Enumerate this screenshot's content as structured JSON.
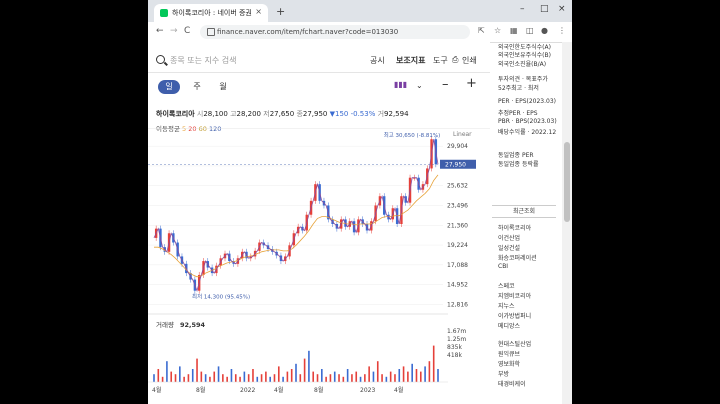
{
  "browser": {
    "tab_title": "하이록코리아 : 네이버 증권",
    "tab_close": "×",
    "new_tab": "+",
    "url": "finance.naver.com/item/fchart.naver?code=013030",
    "nav_back": "←",
    "nav_forward": "→",
    "nav_reload": "C"
  },
  "toolbar": {
    "search_placeholder": "종목 또는 지수 검색",
    "menu": [
      "공시",
      "보조지표",
      "도구",
      "인쇄"
    ]
  },
  "period_tabs": [
    "일",
    "주",
    "월"
  ],
  "stock": {
    "name": "하이록코리아",
    "open_label": "시",
    "open": "28,100",
    "high_label": "고",
    "high": "28,200",
    "low_label": "저",
    "low": "27,650",
    "close_label": "종",
    "close": "27,950",
    "change": "▼150 -0.53%",
    "volume_label": "거",
    "volume": "92,594"
  },
  "moving_avg": {
    "label": "이동평균",
    "p5": "5",
    "p20": "20",
    "p60": "60",
    "p120": "120"
  },
  "chart_data": {
    "type": "line",
    "scale_label": "Linear",
    "y_ticks": [
      29904,
      27768,
      25632,
      23496,
      21360,
      19224,
      17088,
      14952,
      12816
    ],
    "y_tick_labels": [
      "29,904",
      "27,768",
      "25,632",
      "23,496",
      "21,360",
      "19,224",
      "17,088",
      "14,952",
      "12,816"
    ],
    "ylim": [
      12000,
      31000
    ],
    "x_labels": [
      "4월",
      "8월",
      "2022",
      "4월",
      "8월",
      "2023",
      "4월"
    ],
    "high_label": "최고 30,650 (-8.81%)",
    "low_label": "최저 14,300 (95.45%)",
    "current_label": "27,950",
    "current": 27950,
    "high": 30650,
    "low": 14300,
    "price_path": [
      20000,
      21000,
      19000,
      18500,
      20500,
      19500,
      18000,
      17200,
      16200,
      15500,
      14300,
      16000,
      17500,
      16800,
      16200,
      17000,
      17800,
      18300,
      17500,
      17200,
      17800,
      18500,
      17800,
      18000,
      18600,
      19500,
      19200,
      18800,
      18500,
      18100,
      17500,
      18000,
      19200,
      20500,
      21200,
      20800,
      22500,
      24000,
      25800,
      24000,
      23500,
      22000,
      21500,
      21000,
      22000,
      21200,
      21800,
      20600,
      22000,
      21500,
      20800,
      21800,
      23500,
      24500,
      22500,
      22000,
      23200,
      21500,
      24500,
      23800,
      26500,
      26500,
      25200,
      25800,
      27500,
      30650,
      27950
    ],
    "ma_path": [
      19000,
      19000,
      18800,
      18500,
      18200,
      17800,
      17300,
      16800,
      16300,
      16000,
      15800,
      15900,
      16200,
      16400,
      16600,
      16900,
      17100,
      17300,
      17400,
      17500,
      17700,
      17900,
      18000,
      18100,
      18300,
      18500,
      18600,
      18700,
      18700,
      18700,
      18600,
      18600,
      18800,
      19200,
      19700,
      20200,
      20800,
      21500,
      22100,
      22300,
      22300,
      22100,
      21900,
      21700,
      21600,
      21500,
      21500,
      21400,
      21500,
      21500,
      21500,
      21600,
      21900,
      22200,
      22300,
      22300,
      22400,
      22400,
      22700,
      23000,
      23500,
      24000,
      24400,
      24800,
      25300,
      26200,
      26800
    ],
    "volume_label": "거래량",
    "volume_value": "92,594",
    "volume_ticks": [
      "1.67m",
      "1.25m",
      "835k",
      "418k"
    ],
    "colors": {
      "up": "#e5403a",
      "down": "#3a6bd1",
      "ma5": "#e7a33a",
      "ma20": "#8b4c9c",
      "current": "#3f5eab"
    }
  },
  "right_panel": {
    "items": [
      "외국인한도주식수(A)",
      "외국인보유주식수(B)",
      "외국인소진율(B/A)",
      "투자의견 · 목표주가",
      "52주최고 · 최저",
      "PER · EPS(2023.03)",
      "추정PER · EPS",
      "PBR · BPS(2023.03)",
      "배당수익률 · 2022.12",
      "동일업종 PER",
      "동일업종 등락률"
    ],
    "recent_title": "최근조회",
    "recent": [
      "하이록코리아",
      "이건산업",
      "일성건설",
      "화승코퍼레이션",
      "CBI",
      "스페코",
      "지엠비코리아",
      "지누스",
      "이가방법퍼니",
      "메디앙스",
      "현대스틸산업",
      "원익큐브",
      "영보화학",
      "부방",
      "태경비케이"
    ]
  }
}
